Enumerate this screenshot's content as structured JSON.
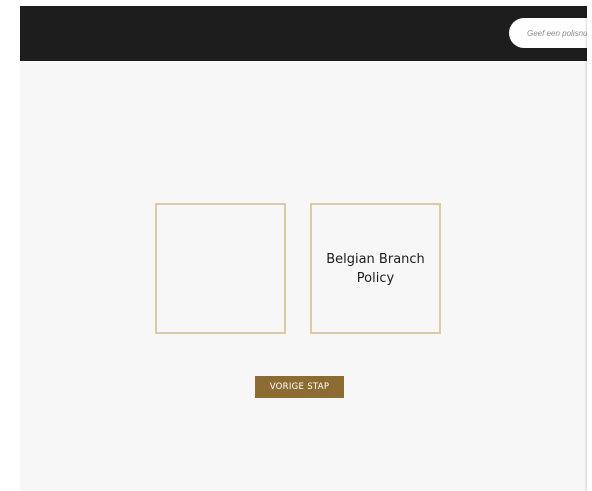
{
  "header": {
    "search": {
      "placeholder": "Geef een polisnummer in"
    }
  },
  "options": [
    {
      "label": ""
    },
    {
      "label": "Belgian Branch Policy"
    }
  ],
  "actions": {
    "back_label": "VORIGE STAP"
  },
  "colors": {
    "header_bg": "#1d1d1d",
    "page_bg": "#f7f7f7",
    "card_border": "#dcc9a6",
    "button_bg": "#8c6c32"
  }
}
